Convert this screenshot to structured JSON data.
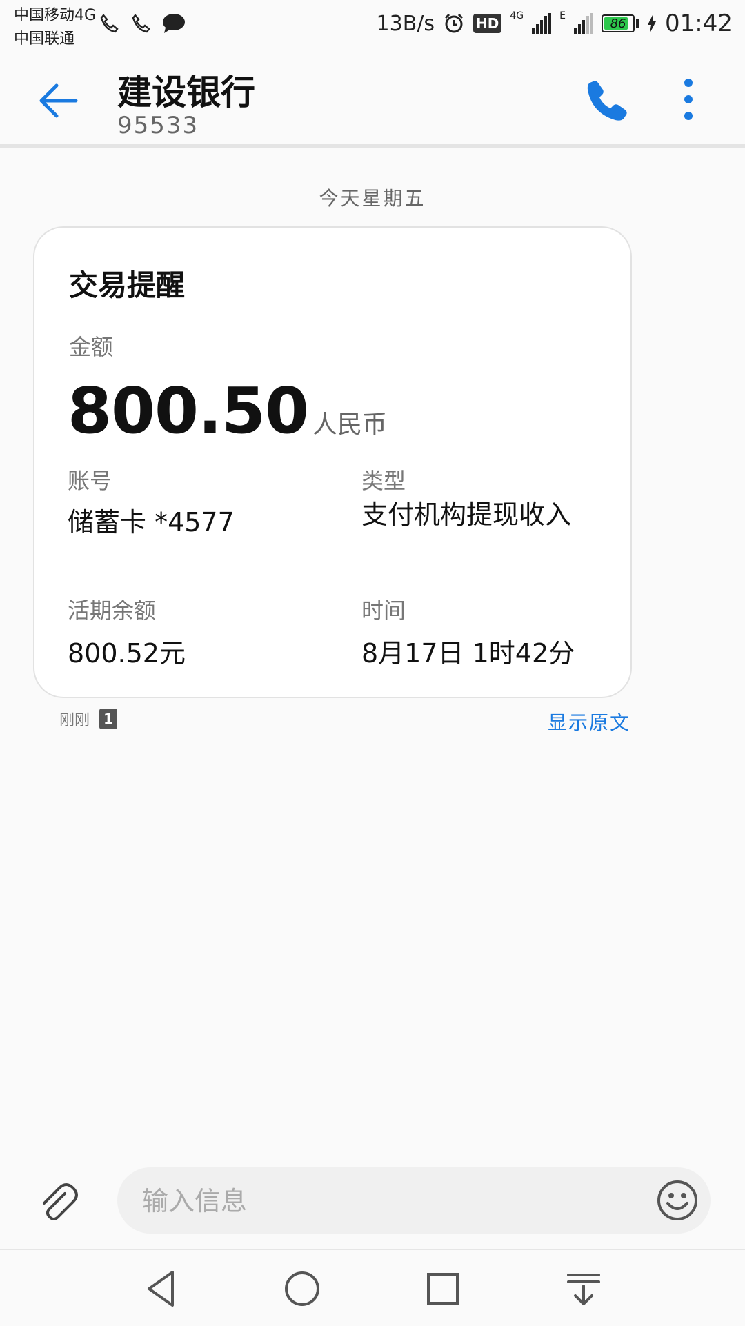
{
  "status_bar": {
    "carrier_1": "中国移动4G",
    "carrier_2": "中国联通",
    "network_speed": "13B/s",
    "hd_badge": "HD",
    "signal_1_label": "4G",
    "signal_2_label": "E",
    "battery_level": "86",
    "time": "01:42",
    "icons": [
      "call-sim1-icon",
      "call-sim2-icon",
      "message-icon",
      "alarm-icon",
      "signal-icon",
      "charging-icon"
    ]
  },
  "header": {
    "title": "建设银行",
    "subtitle": "95533",
    "icons": [
      "back-arrow-icon",
      "phone-icon",
      "more-vert-icon"
    ],
    "accent_color": "#1a7ae0"
  },
  "conversation": {
    "date_separator": "今天星期五",
    "card": {
      "title": "交易提醒",
      "amount_label": "金额",
      "amount_value": "800.50",
      "amount_currency": "人民币",
      "account_label": "账号",
      "account_value": "储蓄卡 *4577",
      "type_label": "类型",
      "type_value": "支付机构提现收入",
      "balance_label": "活期余额",
      "balance_value": "800.52元",
      "time_label": "时间",
      "time_value": "8月17日 1时42分"
    },
    "meta": {
      "sent_time": "刚刚",
      "sim_slot": "1",
      "show_original": "显示原文"
    }
  },
  "composer": {
    "placeholder": "输入信息",
    "value": "",
    "icons": [
      "attachment-icon",
      "emoji-icon"
    ]
  },
  "nav_bar": {
    "icons": [
      "nav-back-icon",
      "nav-home-icon",
      "nav-recents-icon",
      "nav-notifications-icon"
    ]
  }
}
